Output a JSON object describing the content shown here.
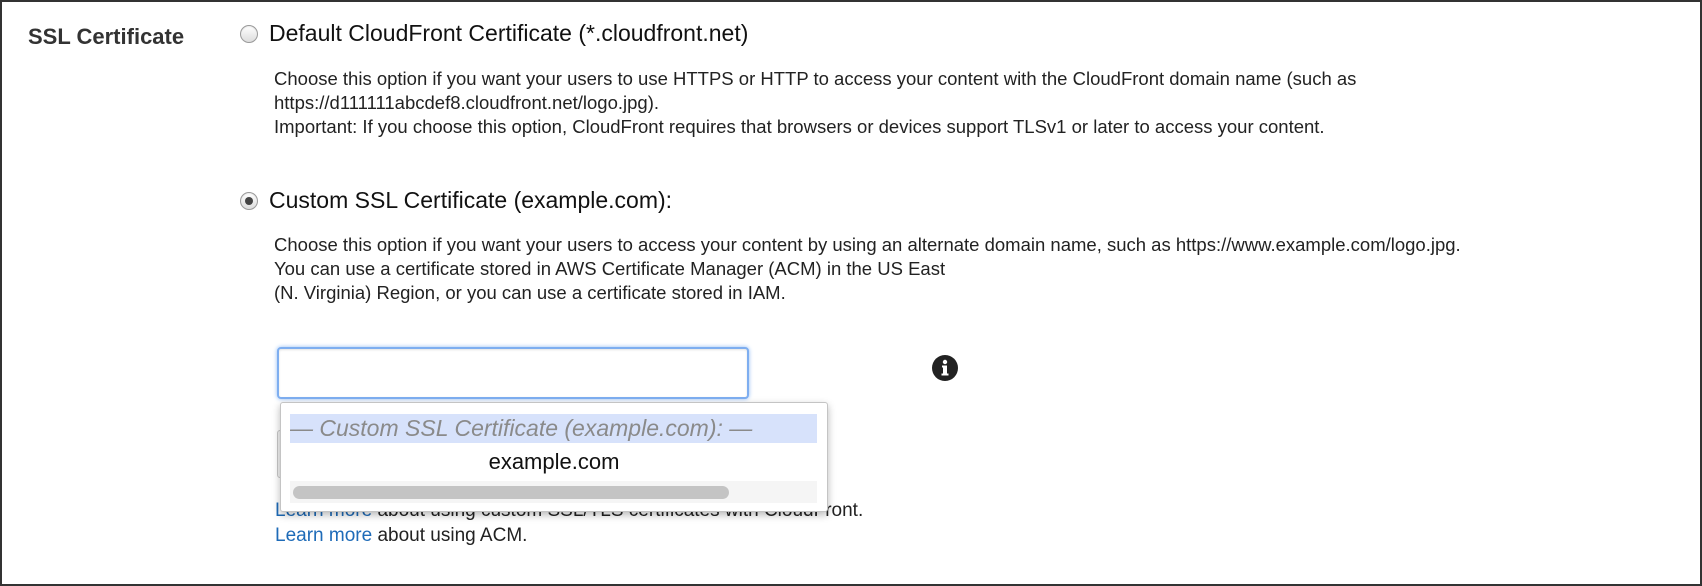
{
  "section": {
    "label": "SSL Certificate"
  },
  "options": [
    {
      "label": "Default CloudFront Certificate (*.cloudfront.net)",
      "selected": false,
      "description": [
        "Choose this option if you want your users to use HTTPS or HTTP to access your content with the CloudFront domain name (such as",
        "https://d111111abcdef8.cloudfront.net/logo.jpg).",
        "Important: If you choose this option, CloudFront requires that browsers or devices support TLSv1 or later to access your content."
      ]
    },
    {
      "label": "Custom SSL Certificate (example.com):",
      "selected": true,
      "description": [
        "Choose this option if you want your users to access your content by using an alternate domain name, such as https://www.example.com/logo.jpg.",
        "You can use a certificate stored in AWS Certificate Manager (ACM) in the US East",
        "(N. Virginia) Region, or you can use a certificate stored in IAM."
      ]
    }
  ],
  "certificate_input": {
    "value": ""
  },
  "dropdown": {
    "group_label": "— Custom SSL Certificate (example.com): —",
    "options": [
      "example.com"
    ]
  },
  "learn_more": [
    {
      "link": "Learn more",
      "text": " about using custom SSL/TLS certificates with CloudFront."
    },
    {
      "link": "Learn more",
      "text": " about using ACM."
    }
  ],
  "icons": {
    "info": "info-icon"
  },
  "colors": {
    "link": "#1e6bb8",
    "focus": "#7eaef0",
    "highlight": "#d7e2fb"
  }
}
